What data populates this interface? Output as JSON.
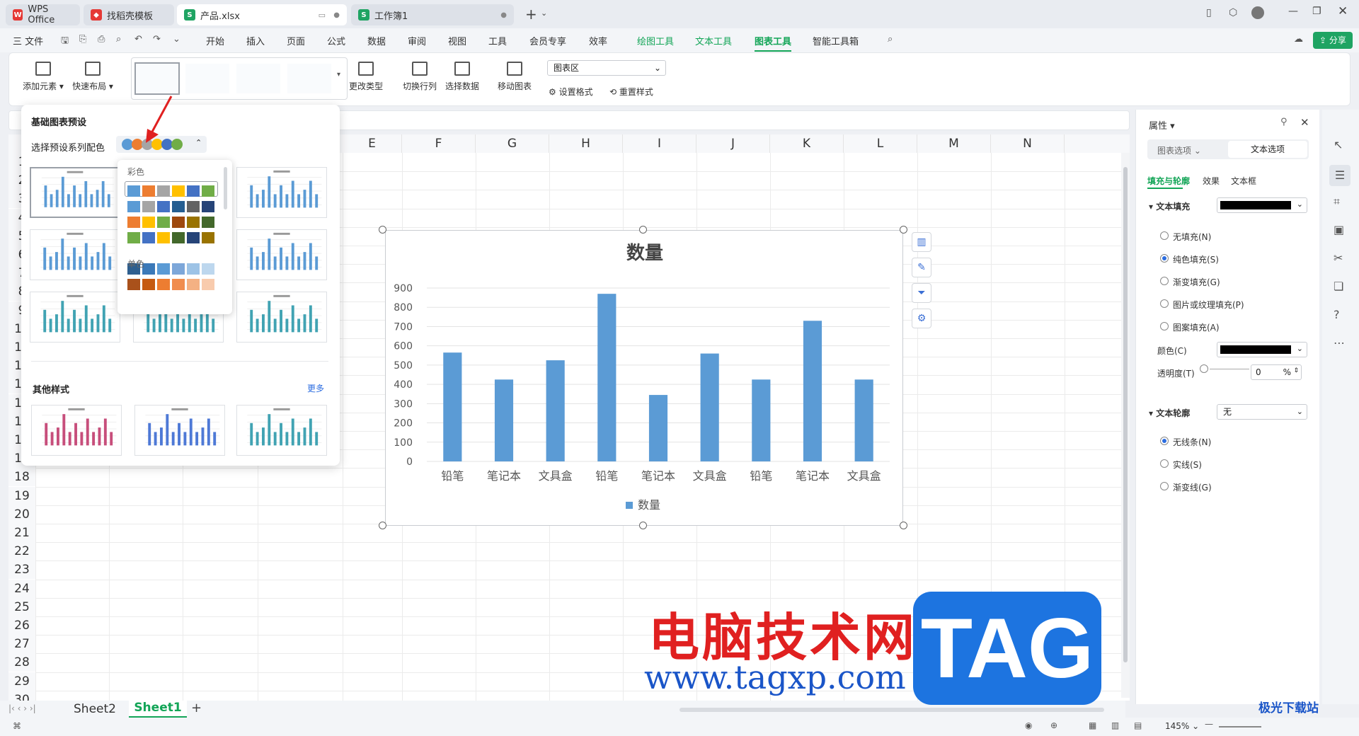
{
  "tabs": [
    {
      "label": "WPS Office"
    },
    {
      "label": "找稻壳模板"
    },
    {
      "label": "产品.xlsx"
    },
    {
      "label": "工作簿1"
    }
  ],
  "menu": {
    "file": "三 文件",
    "items": [
      "开始",
      "插入",
      "页面",
      "公式",
      "数据",
      "审阅",
      "视图",
      "工具",
      "会员专享",
      "效率"
    ],
    "green_items": [
      "绘图工具",
      "文本工具",
      "图表工具",
      "智能工具箱"
    ],
    "share": "分享"
  },
  "ribbon": {
    "add_element": "添加元素",
    "quick_layout": "快速布局",
    "change_type": "更改类型",
    "switch_rowcol": "切换行列",
    "select_data": "选择数据",
    "move_chart": "移动图表",
    "area_select": "图表区",
    "set_format": "设置格式",
    "reset_style": "重置样式"
  },
  "columns": [
    "E",
    "F",
    "G",
    "H",
    "I",
    "J",
    "K",
    "L",
    "M",
    "N"
  ],
  "rows": [
    "1",
    "2",
    "3",
    "4",
    "5",
    "6",
    "7",
    "8",
    "9",
    "10",
    "11",
    "12",
    "13",
    "14",
    "15",
    "16",
    "17",
    "18",
    "19",
    "20",
    "21",
    "22",
    "23",
    "24",
    "25",
    "26",
    "27",
    "28",
    "29",
    "30"
  ],
  "preset": {
    "title": "基础图表预设",
    "select_label": "选择预设系列配色",
    "other_styles": "其他样式",
    "more": "更多",
    "palette_colorful": "彩色",
    "palette_mono": "单色"
  },
  "chart_data": {
    "type": "bar",
    "title": "数量",
    "categories": [
      "铅笔",
      "笔记本",
      "文具盒",
      "铅笔",
      "笔记本",
      "文具盒",
      "铅笔",
      "笔记本",
      "文具盒"
    ],
    "series": [
      {
        "name": "数量",
        "values": [
          565,
          425,
          525,
          870,
          345,
          560,
          425,
          730,
          425
        ]
      }
    ],
    "ylim": [
      0,
      900
    ],
    "yticks": [
      "0",
      "100",
      "200",
      "300",
      "400",
      "500",
      "600",
      "700",
      "800",
      "900"
    ],
    "legend": "bottom",
    "color": "#5b9bd5",
    "grid": true
  },
  "right_panel": {
    "title": "属性",
    "tab_chart": "图表选项",
    "tab_text": "文本选项",
    "sub_fill": "填充与轮廓",
    "sub_effect": "效果",
    "sub_textbox": "文本框",
    "text_fill": "文本填充",
    "fill_options": [
      "无填充(N)",
      "纯色填充(S)",
      "渐变填充(G)",
      "图片或纹理填充(P)",
      "图案填充(A)"
    ],
    "color_label": "颜色(C)",
    "transparency_label": "透明度(T)",
    "transparency_value": "0",
    "percent": "%",
    "text_outline": "文本轮廓",
    "outline_value": "无",
    "outline_options": [
      "无线条(N)",
      "实线(S)",
      "渐变线(G)"
    ]
  },
  "sheets": {
    "sheet2": "Sheet2",
    "sheet1": "Sheet1",
    "add": "+"
  },
  "status": {
    "zoom": "145%"
  },
  "watermark": {
    "cn": "电脑技术网",
    "url": "www.tagxp.com",
    "tag": "TAG",
    "corner": "极光下载站"
  }
}
